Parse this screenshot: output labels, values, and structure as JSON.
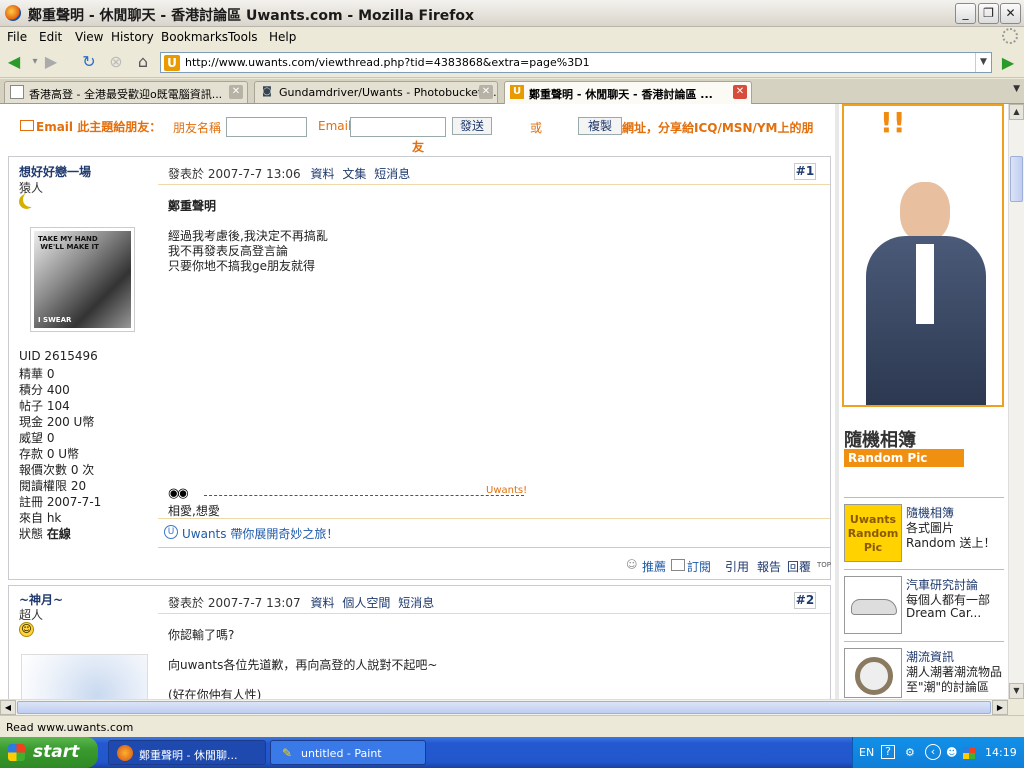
{
  "window": {
    "title": "鄭重聲明 - 休閒聊天 - 香港討論區 Uwants.com - Mozilla Firefox",
    "buttons": {
      "minimize": "_",
      "restore": "❐",
      "close": "✕"
    }
  },
  "menu": [
    "File",
    "Edit",
    "View",
    "History",
    "Bookmarks",
    "Tools",
    "Help"
  ],
  "address": {
    "url": "http://www.uwants.com/viewthread.php?tid=4383868&extra=page%3D1",
    "favicon": "U"
  },
  "tabs": [
    {
      "label": "香港高登 - 全港最受歡迎o既電腦資訊...",
      "icon": "doc-icon",
      "active": false
    },
    {
      "label": "Gundamdriver/Uwants - Photobucket -...",
      "icon": "camera-icon",
      "active": false
    },
    {
      "label": "鄭重聲明 - 休閒聊天 - 香港討論區 ...",
      "icon": "uwants-icon",
      "active": true
    }
  ],
  "email_bar": {
    "title": "Email 此主題給朋友：",
    "friend_name_label": "朋友名稱",
    "email_label": "Email",
    "send_button": "發送",
    "or_label": "或",
    "copy_button": "複製",
    "share_text": "網址，分享給ICQ/MSN/YM上的朋",
    "share_text_wrap": "友"
  },
  "posts": [
    {
      "author": "想好好戀一場",
      "rank": "猿人",
      "status_icon": "moon-icon",
      "avatar_text_top": "TAKE MY HAND\n WE'LL MAKE IT",
      "avatar_text_bottom": "I SWEAR",
      "stats": [
        "UID 2615496",
        "精華 0",
        "積分 400",
        "帖子 104",
        "現金 200 U幣",
        "威望 0",
        "存款 0 U幣",
        "報價次數 0 次",
        "閱讀權限 20",
        "註冊 2007-7-1",
        "來自 hk"
      ],
      "online_label": "狀態",
      "online_value": "在線",
      "posted_at": "發表於 2007-7-7 13:06",
      "links": [
        "資料",
        "文集",
        "短消息"
      ],
      "number": "#1",
      "subject": "鄭重聲明",
      "body": [
        "經過我考慮後,我決定不再搞亂",
        "我不再發表反高登言論",
        "只要你地不搞我ge朋友就得"
      ],
      "signature_brand": "Uwants!",
      "signature_text": "相愛,想愛",
      "promo": "Uwants 帶你展開奇妙之旅！",
      "actions": [
        "推薦",
        "訂閱",
        "引用",
        "報告",
        "回覆",
        "TOP"
      ]
    },
    {
      "author": "~神月~",
      "rank": "超人",
      "status_icon": "smiley-icon",
      "posted_at": "發表於 2007-7-7 13:07",
      "links": [
        "資料",
        "個人空間",
        "短消息"
      ],
      "number": "#2",
      "body": [
        "你認輸了嗎?",
        "",
        "向uwants各位先道歉，再向高登的人說對不起吧~",
        "",
        "(好在你仲有人性)"
      ]
    }
  ],
  "ads": {
    "banner_text": "!!",
    "random_pic_title": "隨機相簿",
    "random_pic_sub": "Random Pic",
    "items": [
      {
        "link": "隨機相簿",
        "line1": "各式圖片",
        "line2": "Random 送上！",
        "thumb": "Uwants Random Pic"
      },
      {
        "link": "汽車研究討論",
        "line1": "每個人都有一部",
        "line2": "Dream Car...",
        "thumb": "car"
      },
      {
        "link": "潮流資訊",
        "line1": "潮人潮著潮流物品",
        "line2": "至\"潮\"的討論區",
        "thumb": "watch"
      }
    ]
  },
  "status": "Read www.uwants.com",
  "taskbar": {
    "start": "start",
    "tasks": [
      {
        "label": "鄭重聲明 - 休閒聊...",
        "icon": "firefox-icon",
        "active": true
      },
      {
        "label": "untitled - Paint",
        "icon": "paint-icon",
        "active": false
      }
    ],
    "lang": "EN",
    "clock": "14:19"
  }
}
